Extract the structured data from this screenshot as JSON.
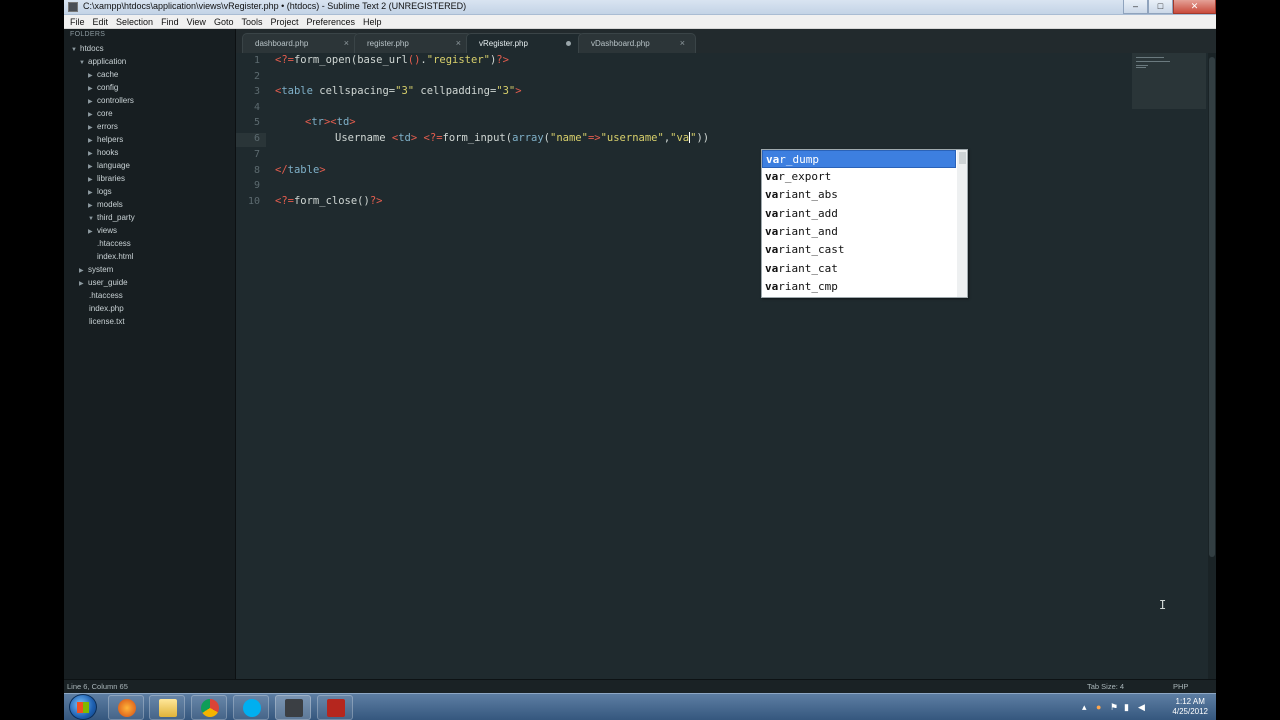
{
  "window": {
    "title": "C:\\xampp\\htdocs\\application\\views\\vRegister.php • (htdocs) - Sublime Text 2 (UNREGISTERED)",
    "buttons": {
      "minimize": "–",
      "maximize": "□",
      "close": "✕"
    }
  },
  "menu": [
    "File",
    "Edit",
    "Selection",
    "Find",
    "View",
    "Goto",
    "Tools",
    "Project",
    "Preferences",
    "Help"
  ],
  "sidebar": {
    "header": "FOLDERS",
    "items": [
      {
        "label": "htdocs",
        "arrow": "▼"
      },
      {
        "label": "application",
        "arrow": "▼"
      },
      {
        "label": "cache",
        "arrow": "▶"
      },
      {
        "label": "config",
        "arrow": "▶"
      },
      {
        "label": "controllers",
        "arrow": "▶"
      },
      {
        "label": "core",
        "arrow": "▶"
      },
      {
        "label": "errors",
        "arrow": "▶"
      },
      {
        "label": "helpers",
        "arrow": "▶"
      },
      {
        "label": "hooks",
        "arrow": "▶"
      },
      {
        "label": "language",
        "arrow": "▶"
      },
      {
        "label": "libraries",
        "arrow": "▶"
      },
      {
        "label": "logs",
        "arrow": "▶"
      },
      {
        "label": "models",
        "arrow": "▶"
      },
      {
        "label": "third_party",
        "arrow": "▼"
      },
      {
        "label": "views",
        "arrow": "▶"
      },
      {
        "label": ".htaccess",
        "arrow": ""
      },
      {
        "label": "index.html",
        "arrow": ""
      },
      {
        "label": "system",
        "arrow": "▶"
      },
      {
        "label": "user_guide",
        "arrow": "▶"
      },
      {
        "label": ".htaccess",
        "arrow": ""
      },
      {
        "label": "index.php",
        "arrow": ""
      },
      {
        "label": "license.txt",
        "arrow": ""
      }
    ]
  },
  "tabs": [
    {
      "label": "dashboard.php",
      "close": "×"
    },
    {
      "label": "register.php",
      "close": "×"
    },
    {
      "label": "vRegister.php",
      "close": ""
    },
    {
      "label": "vDashboard.php",
      "close": "×"
    }
  ],
  "editor": {
    "line_numbers": [
      "1",
      "2",
      "3",
      "4",
      "5",
      "6",
      "7",
      "8",
      "9",
      "10"
    ],
    "lines": {
      "l1": {
        "a": "<?=",
        "b": "form_open(",
        "c": "base_url",
        "d": "()",
        "e": ".",
        "f": "\"register\"",
        "g": ")",
        "h": "?>"
      },
      "l3": {
        "a": "<",
        "b": "table",
        "c": " cellspacing=",
        "d": "\"3\"",
        "e": " cellpadding=",
        "f": "\"3\"",
        "g": ">"
      },
      "l5": {
        "a": "<",
        "b": "tr",
        "c": "><",
        "d": "td",
        "e": ">"
      },
      "l6": {
        "a": "Username ",
        "b": "<",
        "c": "td",
        "d": "> ",
        "e": "<?=",
        "f": "form_input(",
        "g": "array",
        "h": "(",
        "i": "\"name\"",
        "j": "=>",
        "k": "\"username\"",
        "l": ",",
        "m": "\"va",
        "n": "\"",
        "o": "))"
      },
      "l8": {
        "a": "</",
        "b": "table",
        "c": ">"
      },
      "l10": {
        "a": "<?=",
        "b": "form_close()",
        "c": "?>"
      }
    }
  },
  "autocomplete": {
    "prefix": "va",
    "items": [
      {
        "rest": "r_dump"
      },
      {
        "rest": "r_export"
      },
      {
        "rest": "riant_abs"
      },
      {
        "rest": "riant_add"
      },
      {
        "rest": "riant_and"
      },
      {
        "rest": "riant_cast"
      },
      {
        "rest": "riant_cat"
      },
      {
        "rest": "riant_cmp"
      }
    ]
  },
  "status": {
    "position": "Line 6, Column 65",
    "tab_size": "Tab Size: 4",
    "syntax": "PHP"
  },
  "taskbar": {
    "clock_time": "1:12 AM",
    "clock_date": "4/25/2012"
  },
  "colors": {
    "editor_bg": "#1f2a2e",
    "tag": "#e35d4e",
    "string": "#d7cf6b",
    "keyword": "#7fb0c8",
    "selection": "#3d7fe0"
  }
}
